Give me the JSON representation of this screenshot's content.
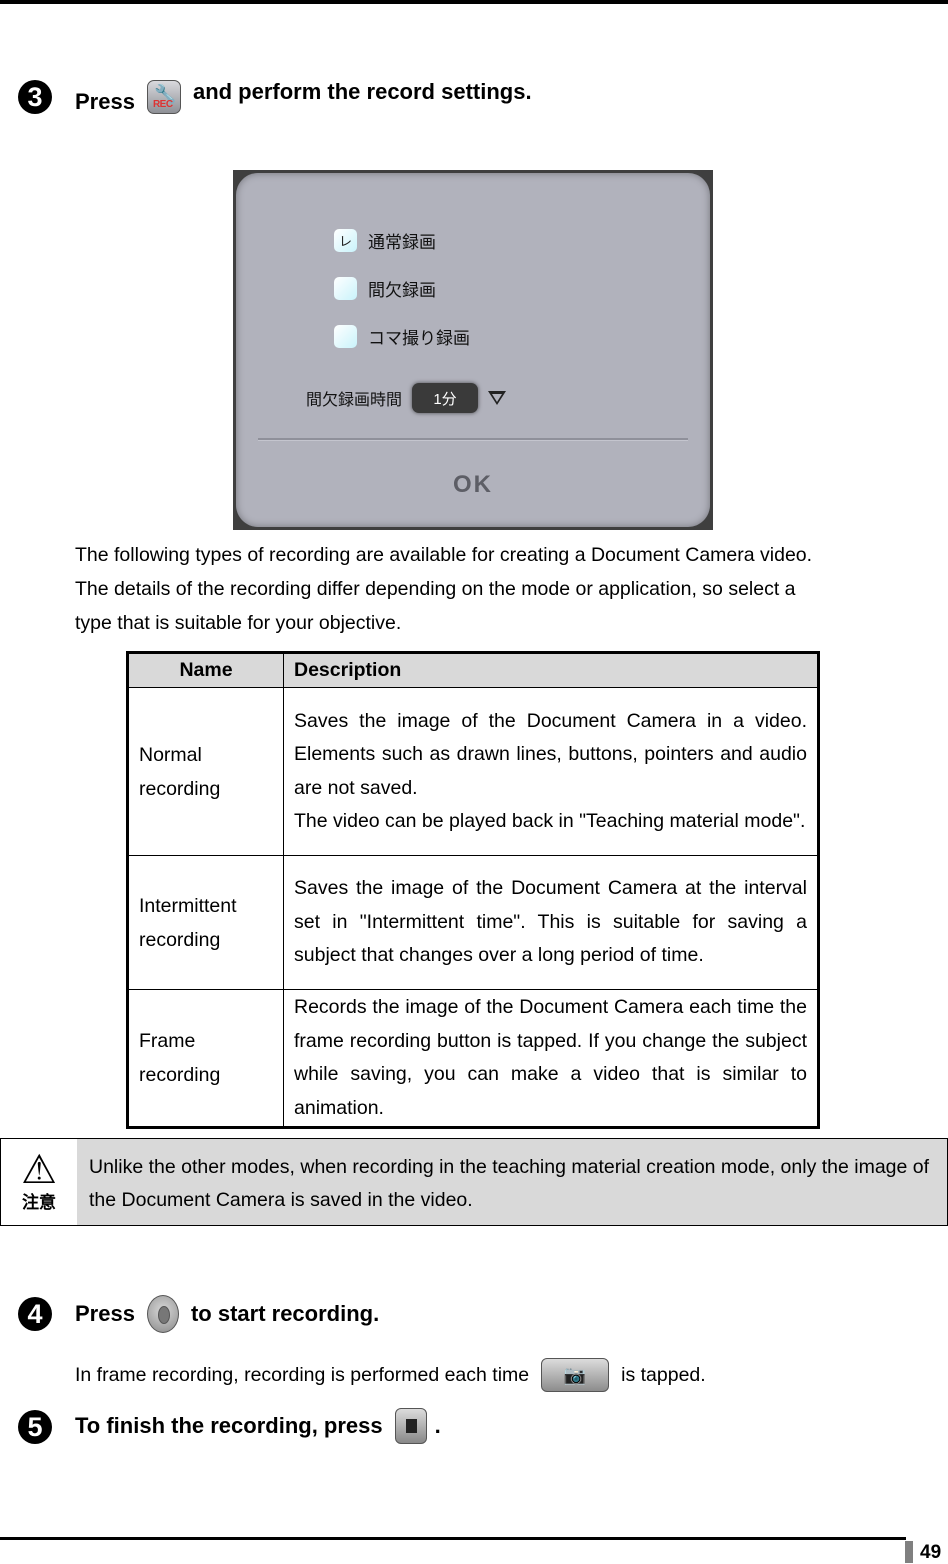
{
  "steps": {
    "s3": {
      "number": "3",
      "before": "Press",
      "icon": "tools-rec-settings-icon",
      "after": "and perform the record settings."
    },
    "s4": {
      "number": "4",
      "before": "Press",
      "icon": "record-button-icon",
      "after": "to start recording."
    },
    "s4_sub": {
      "before": "In frame recording, recording is performed each time",
      "icon": "frame-record-camera-icon",
      "after": "is tapped."
    },
    "s5": {
      "number": "5",
      "before": "To finish the recording, press",
      "icon": "stop-button-icon",
      "after": "."
    }
  },
  "dialog": {
    "options": [
      {
        "label": "通常録画",
        "checked": true,
        "check_mark": "レ"
      },
      {
        "label": "間欠録画",
        "checked": false,
        "check_mark": ""
      },
      {
        "label": "コマ撮り録画",
        "checked": false,
        "check_mark": ""
      }
    ],
    "interval_label": "間欠録画時間",
    "interval_value": "1分",
    "ok_label": "OK"
  },
  "intro": [
    "The following types of recording are available for creating a Document Camera video.",
    "The details of the recording differ depending on the mode or application, so select a",
    "type that is suitable for your objective."
  ],
  "table": {
    "headers": [
      "Name",
      "Description"
    ],
    "rows": [
      {
        "name": "Normal recording",
        "description": "Saves the image of the Document Camera in a video. Elements such as drawn lines, buttons, pointers and audio are not saved.",
        "description2": "The video can be played back in \"Teaching material mode\"."
      },
      {
        "name": "Intermittent recording",
        "description": "Saves the image of the Document Camera at the interval set in \"Intermittent time\". This is suitable for saving a subject that changes over a long period of time."
      },
      {
        "name": "Frame recording",
        "description": "Records the image of the Document Camera each time the frame recording button is tapped. If you change the subject while saving, you can make a video that is similar to animation."
      }
    ]
  },
  "note": {
    "icon_label": "注意",
    "text": "Unlike the other modes, when recording in the teaching material creation mode, only the image of the Document Camera is saved in the video."
  },
  "footer": {
    "page_number": "49"
  }
}
